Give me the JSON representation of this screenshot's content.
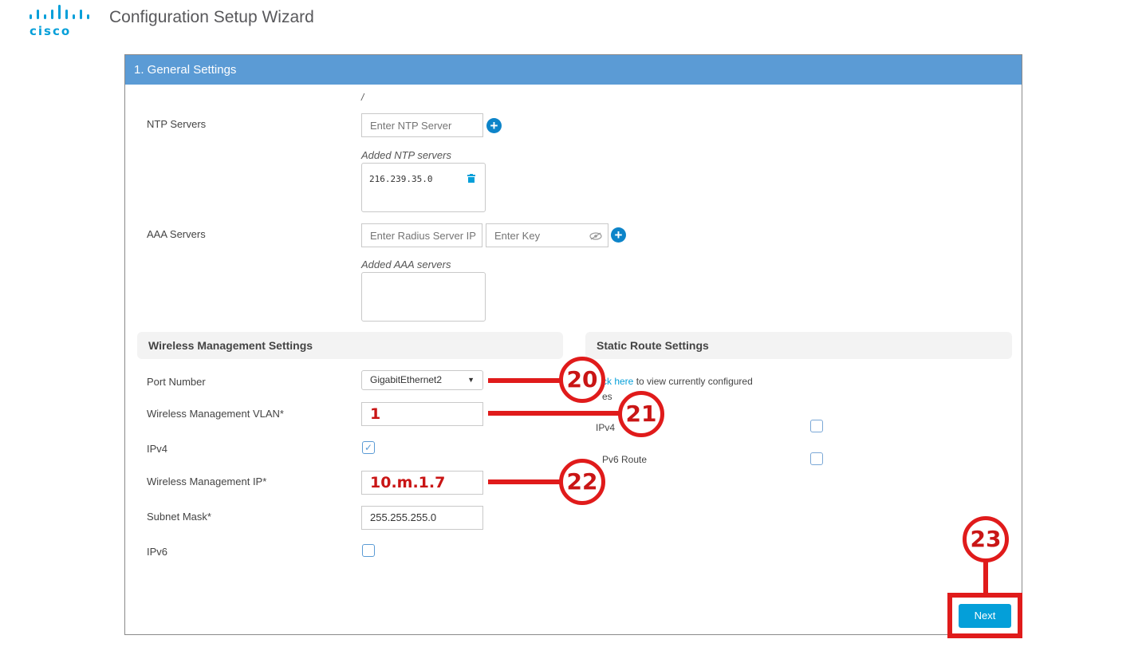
{
  "header": {
    "logo_text": "cisco",
    "title": "Configuration Setup Wizard"
  },
  "panel": {
    "title": "1. General Settings",
    "slash": "/"
  },
  "ntp": {
    "label": "NTP Servers",
    "placeholder": "Enter NTP Server",
    "added_label": "Added NTP servers",
    "servers": [
      "216.239.35.0"
    ]
  },
  "aaa": {
    "label": "AAA Servers",
    "ip_placeholder": "Enter Radius Server IP",
    "key_placeholder": "Enter Key",
    "added_label": "Added AAA servers"
  },
  "wireless": {
    "section_title": "Wireless Management Settings",
    "port_label": "Port Number",
    "port_value": "GigabitEthernet2",
    "vlan_label": "Wireless Management VLAN*",
    "vlan_value": "1",
    "ipv4_label": "IPv4",
    "ipv4_checked": true,
    "ip_label": "Wireless Management IP*",
    "ip_value": "10.m.1.7",
    "subnet_label": "Subnet Mask*",
    "subnet_value": "255.255.255.0",
    "ipv6_label": "IPv6",
    "ipv6_checked": false
  },
  "static_route": {
    "section_title": "Static Route Settings",
    "link_text": "ck here",
    "link_suffix": " to view currently configured",
    "link_line2": "es",
    "ipv4_label": "IPv4",
    "ipv6_label": "Pv6 Route"
  },
  "callouts": [
    "20",
    "21",
    "22",
    "23"
  ],
  "next_label": "Next",
  "colors": {
    "header_bar": "#5b9bd5",
    "accent": "#049fd9",
    "callout_red": "#e01b1b"
  }
}
